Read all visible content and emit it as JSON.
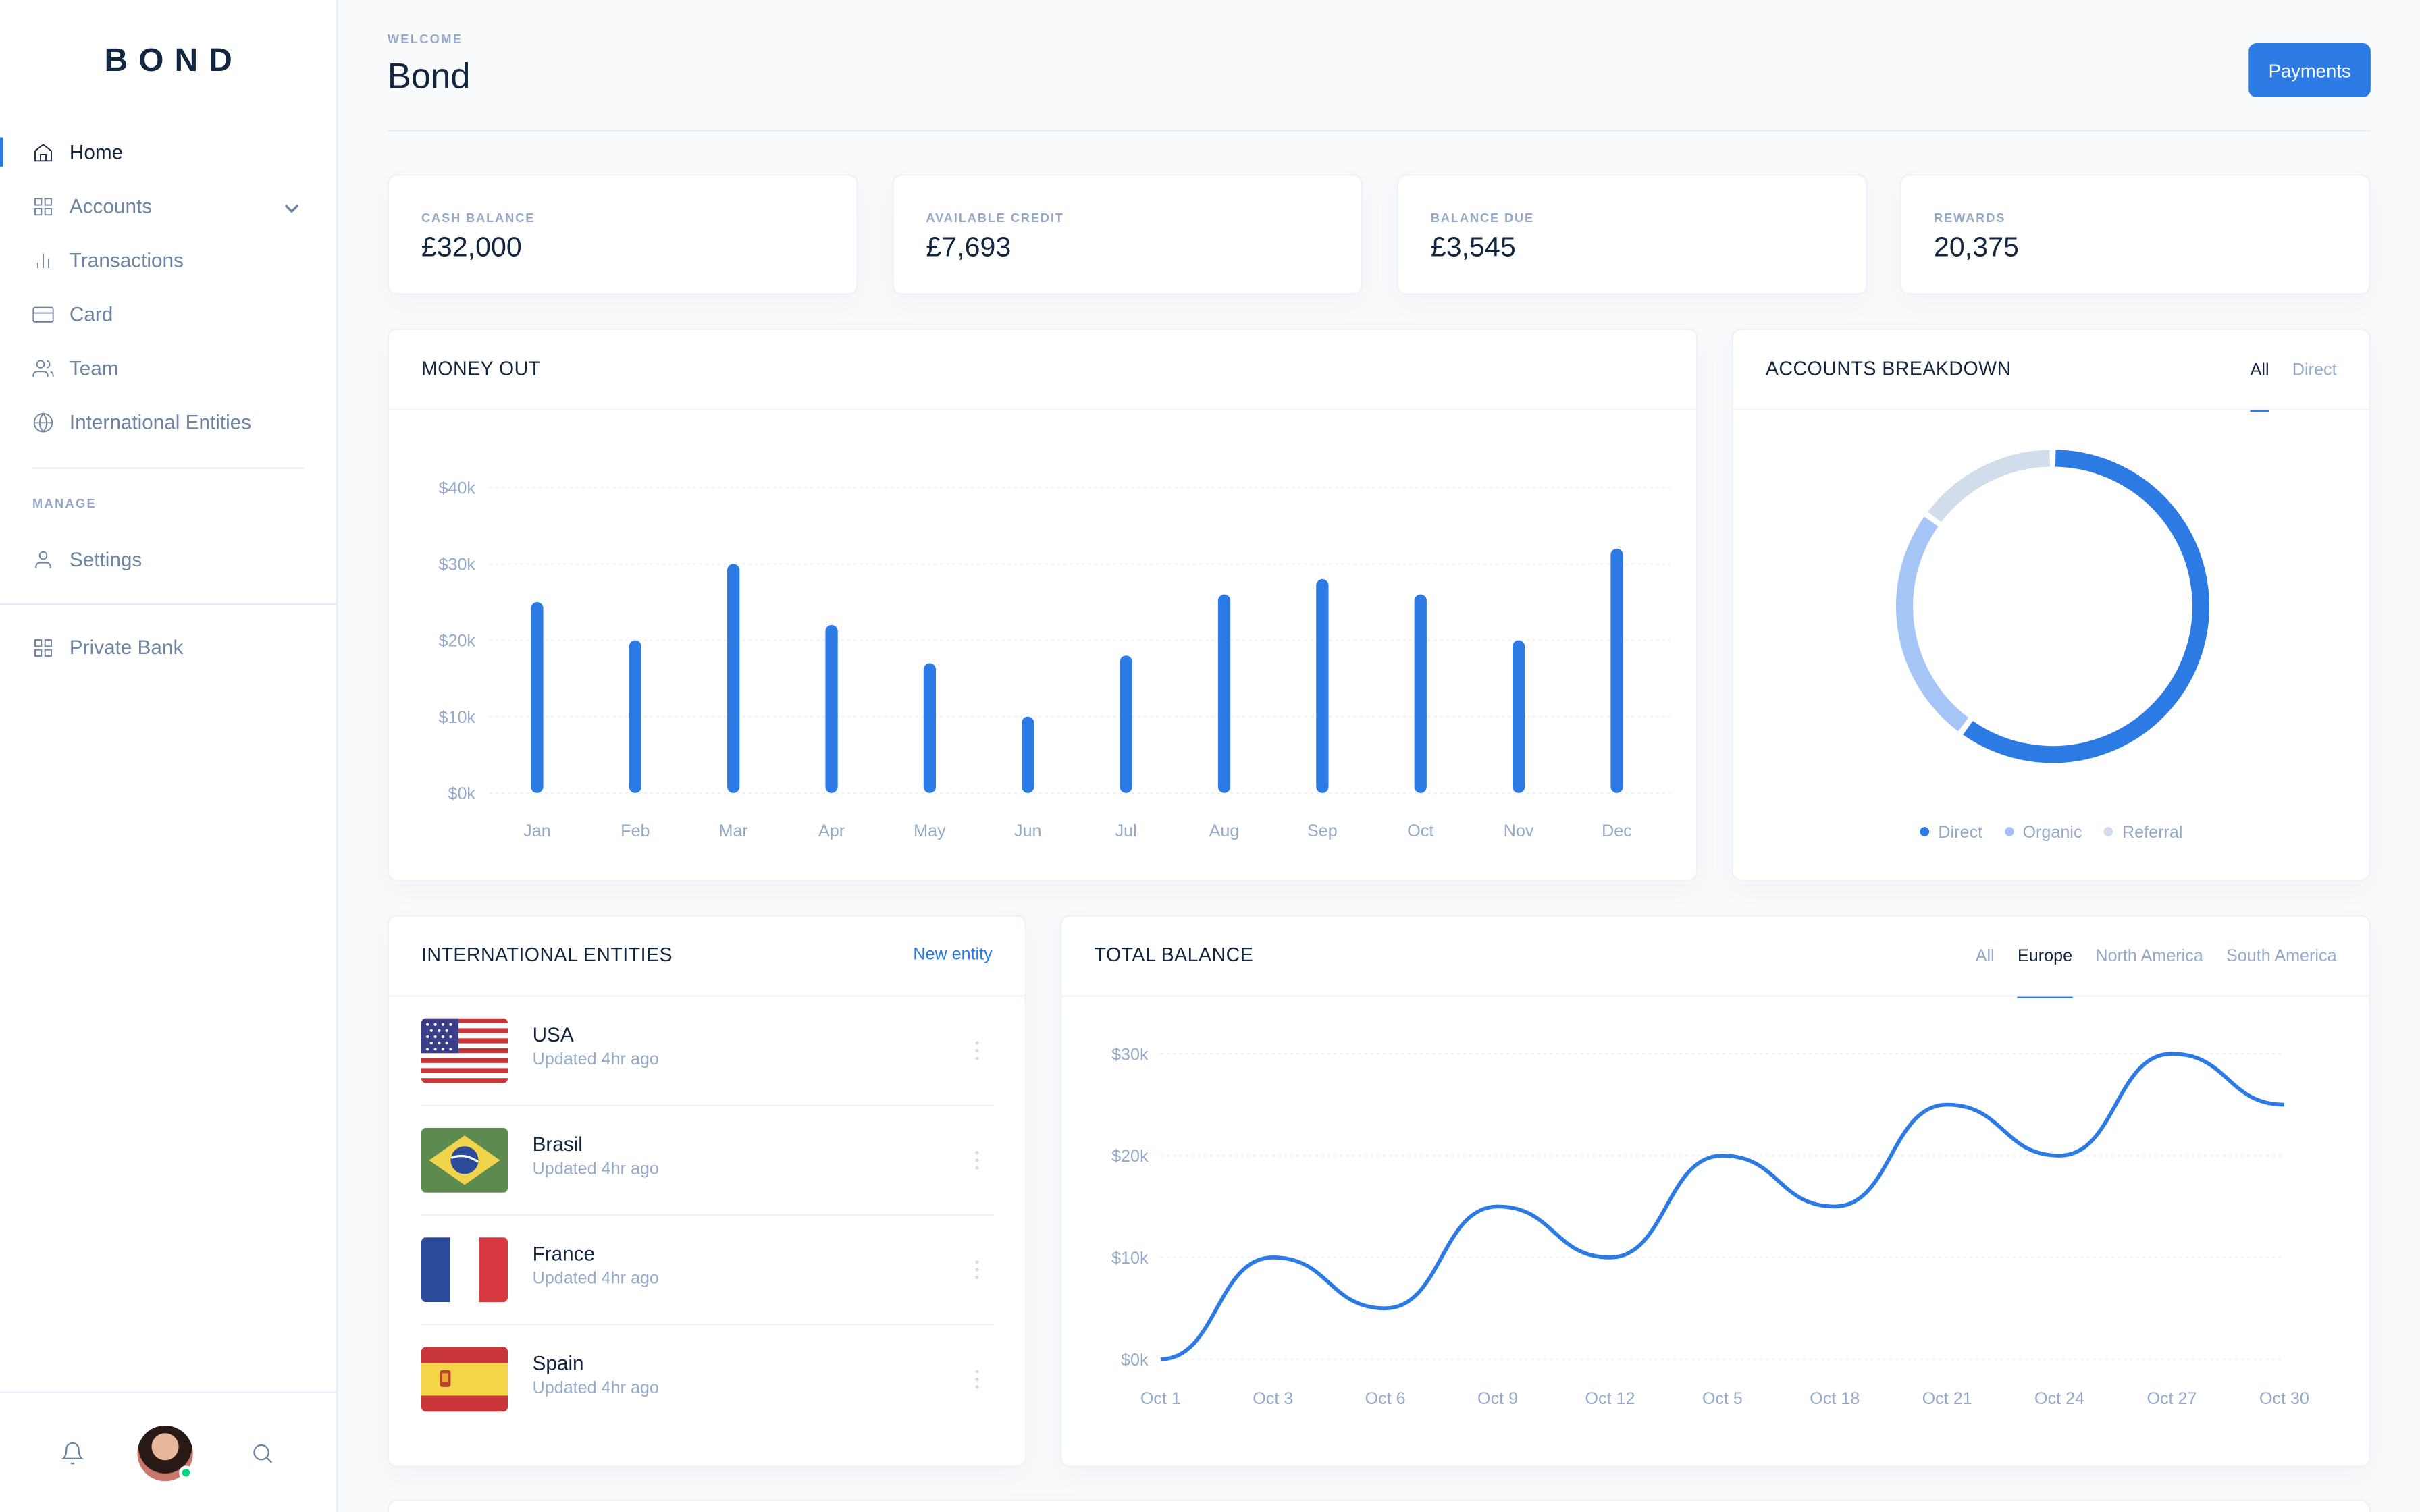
{
  "brand": "BOND",
  "sidebar": {
    "items": [
      {
        "label": "Home",
        "icon": "home-icon"
      },
      {
        "label": "Accounts",
        "icon": "grid-icon"
      },
      {
        "label": "Transactions",
        "icon": "bar-chart-icon"
      },
      {
        "label": "Card",
        "icon": "credit-card-icon"
      },
      {
        "label": "Team",
        "icon": "users-icon"
      },
      {
        "label": "International Entities",
        "icon": "globe-icon"
      }
    ],
    "manage_label": "MANAGE",
    "manage_items": [
      {
        "label": "Settings",
        "icon": "user-icon"
      }
    ],
    "extra_items": [
      {
        "label": "Private Bank",
        "icon": "grid-icon"
      }
    ]
  },
  "header": {
    "pretitle": "WELCOME",
    "title": "Bond",
    "button": "Payments"
  },
  "stats": [
    {
      "label": "CASH BALANCE",
      "value": "£32,000"
    },
    {
      "label": "AVAILABLE CREDIT",
      "value": "£7,693"
    },
    {
      "label": "BALANCE DUE",
      "value": "£3,545"
    },
    {
      "label": "REWARDS",
      "value": "20,375"
    }
  ],
  "money_out": {
    "title": "MONEY OUT"
  },
  "accounts_breakdown": {
    "title": "ACCOUNTS BREAKDOWN",
    "tabs": [
      "All",
      "Direct"
    ],
    "active_tab": "All"
  },
  "entities": {
    "title": "INTERNATIONAL ENTITIES",
    "link": "New entity",
    "items": [
      {
        "name": "USA",
        "updated": "Updated 4hr ago",
        "flag": "us"
      },
      {
        "name": "Brasil",
        "updated": "Updated 4hr ago",
        "flag": "br"
      },
      {
        "name": "France",
        "updated": "Updated 4hr ago",
        "flag": "fr"
      },
      {
        "name": "Spain",
        "updated": "Updated 4hr ago",
        "flag": "es"
      }
    ]
  },
  "total_balance": {
    "title": "TOTAL BALANCE",
    "tabs": [
      "All",
      "Europe",
      "North America",
      "South America"
    ],
    "active_tab": "Europe"
  },
  "colors": {
    "accent": "#2c7be5",
    "organic": "#a6c5f7",
    "referral": "#d2ddec"
  },
  "chart_data": [
    {
      "type": "bar",
      "title": "MONEY OUT",
      "categories": [
        "Jan",
        "Feb",
        "Mar",
        "Apr",
        "May",
        "Jun",
        "Jul",
        "Aug",
        "Sep",
        "Oct",
        "Nov",
        "Dec"
      ],
      "values": [
        25,
        20,
        30,
        22,
        17,
        10,
        18,
        26,
        28,
        26,
        20,
        32
      ],
      "yticks": [
        "$0k",
        "$10k",
        "$20k",
        "$30k",
        "$40k"
      ],
      "ylim": [
        0,
        40
      ],
      "grid": true
    },
    {
      "type": "pie",
      "title": "ACCOUNTS BREAKDOWN",
      "labels": [
        "Direct",
        "Organic",
        "Referral"
      ],
      "values": [
        60,
        25,
        15
      ],
      "colors": [
        "#2c7be5",
        "#a6c5f7",
        "#d2ddec"
      ],
      "legend": "bottom"
    },
    {
      "type": "line",
      "title": "TOTAL BALANCE",
      "x": [
        "Oct 1",
        "Oct 3",
        "Oct 6",
        "Oct 9",
        "Oct 12",
        "Oct 5",
        "Oct 18",
        "Oct 21",
        "Oct 24",
        "Oct 27",
        "Oct 30"
      ],
      "values": [
        0,
        10,
        5,
        15,
        10,
        20,
        15,
        25,
        20,
        30,
        25
      ],
      "yticks": [
        "$0k",
        "$10k",
        "$20k",
        "$30k"
      ],
      "ylim": [
        0,
        30
      ],
      "grid": true
    }
  ]
}
